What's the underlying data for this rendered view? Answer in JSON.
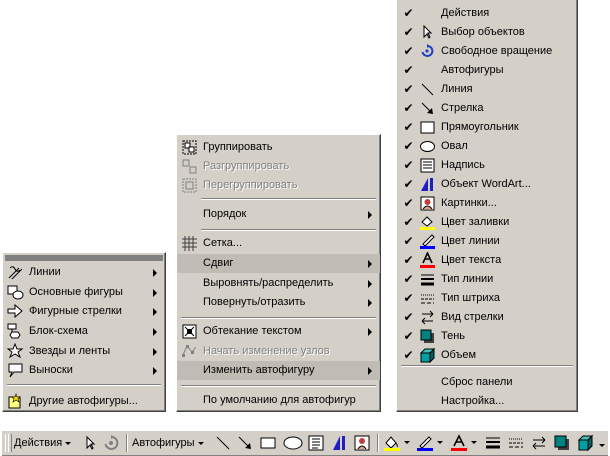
{
  "autoshapes_menu": {
    "items": [
      {
        "label": "Линии",
        "icon": "lines-icon"
      },
      {
        "label": "Основные фигуры",
        "icon": "basic-shapes-icon"
      },
      {
        "label": "Фигурные стрелки",
        "icon": "block-arrows-icon"
      },
      {
        "label": "Блок-схема",
        "icon": "flowchart-icon"
      },
      {
        "label": "Звезды и ленты",
        "icon": "stars-banners-icon"
      },
      {
        "label": "Выноски",
        "icon": "callouts-icon"
      }
    ],
    "more": {
      "label": "Другие автофигуры...",
      "icon": "more-autoshapes-icon"
    }
  },
  "actions_menu": {
    "group": "Группировать",
    "ungroup": "Разгруппировать",
    "regroup": "Перегруппировать",
    "order": "Порядок",
    "grid": "Сетка...",
    "nudge": "Сдвиг",
    "align": "Выровнять/распределить",
    "rotate": "Повернуть/отразить",
    "wrap": "Обтекание текстом",
    "edit_points": "Начать изменение узлов",
    "change_shape": "Изменить автофигуру",
    "defaults": "По умолчанию для автофигур"
  },
  "customize_menu": {
    "items": [
      {
        "label": "Действия",
        "checked": true,
        "icon": ""
      },
      {
        "label": "Выбор объектов",
        "checked": true,
        "icon": "select-objects-icon"
      },
      {
        "label": "Свободное вращение",
        "checked": true,
        "icon": "free-rotate-icon"
      },
      {
        "label": "Автофигуры",
        "checked": true,
        "icon": ""
      },
      {
        "label": "Линия",
        "checked": true,
        "icon": "line-icon"
      },
      {
        "label": "Стрелка",
        "checked": true,
        "icon": "arrow-icon"
      },
      {
        "label": "Прямоугольник",
        "checked": true,
        "icon": "rectangle-icon"
      },
      {
        "label": "Овал",
        "checked": true,
        "icon": "oval-icon"
      },
      {
        "label": "Надпись",
        "checked": true,
        "icon": "text-box-icon"
      },
      {
        "label": "Объект WordArt...",
        "checked": true,
        "icon": "wordart-icon"
      },
      {
        "label": "Картинки...",
        "checked": true,
        "icon": "clipart-icon"
      },
      {
        "label": "Цвет заливки",
        "checked": true,
        "icon": "fill-color-icon"
      },
      {
        "label": "Цвет линии",
        "checked": true,
        "icon": "line-color-icon"
      },
      {
        "label": "Цвет текста",
        "checked": true,
        "icon": "font-color-icon"
      },
      {
        "label": "Тип линии",
        "checked": true,
        "icon": "line-style-icon"
      },
      {
        "label": "Тип штриха",
        "checked": true,
        "icon": "dash-style-icon"
      },
      {
        "label": "Вид стрелки",
        "checked": true,
        "icon": "arrow-style-icon"
      },
      {
        "label": "Тень",
        "checked": true,
        "icon": "shadow-icon"
      },
      {
        "label": "Объем",
        "checked": true,
        "icon": "3d-icon"
      }
    ],
    "reset": "Сброс панели",
    "customize": "Настройка..."
  },
  "toolbar": {
    "actions_label": "Действия",
    "autoshapes_label": "Автофигуры",
    "fill_color": "#ffff00",
    "line_color": "#0000ff",
    "font_color": "#ff0000"
  },
  "check_mark": "✔"
}
